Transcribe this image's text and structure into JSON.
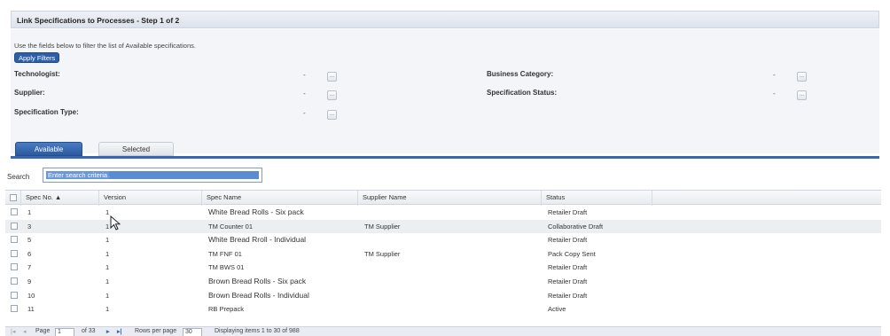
{
  "window": {
    "title": "Link Specifications to Processes - Step 1 of 2"
  },
  "filters": {
    "hint": "Use the fields below to filter the list of Available specifications.",
    "apply_label": "Apply Filters",
    "technologist_label": "Technologist:",
    "supplier_label": "Supplier:",
    "spec_type_label": "Specification Type:",
    "business_category_label": "Business Category:",
    "spec_status_label": "Specification Status:",
    "dash": "-",
    "lookup": "..."
  },
  "tabs": {
    "available": "Available",
    "selected": "Selected"
  },
  "search": {
    "label": "Search",
    "placeholder": "Enter search criteria"
  },
  "grid": {
    "columns": [
      "Spec No. ▲",
      "Version",
      "Spec Name",
      "Supplier Name",
      "Status"
    ],
    "rows": [
      [
        "1",
        "1",
        "White Bread Rolls - Six pack",
        "",
        "Retailer Draft"
      ],
      [
        "3",
        "1",
        "TM Counter 01",
        "TM Supplier",
        "Collaborative Draft"
      ],
      [
        "5",
        "1",
        "White Bread Rroll - Individual",
        "",
        "Retailer Draft"
      ],
      [
        "6",
        "1",
        "TM FNF 01",
        "TM Supplier",
        "Pack Copy Sent"
      ],
      [
        "7",
        "1",
        "TM BWS 01",
        "",
        "Retailer Draft"
      ],
      [
        "9",
        "1",
        "Brown Bread Rolls - Six pack",
        "",
        "Retailer Draft"
      ],
      [
        "10",
        "1",
        "Brown Bread Rolls - Individual",
        "",
        "Retailer Draft"
      ],
      [
        "11",
        "1",
        "RB Prepack",
        "",
        "Active"
      ]
    ]
  },
  "pager": {
    "page_label": "Page",
    "page_value": "1",
    "of_label": "of 33",
    "rows_label": "Rows per page",
    "rows_value": "30",
    "display_text": "Displaying items 1 to 30 of 988"
  }
}
